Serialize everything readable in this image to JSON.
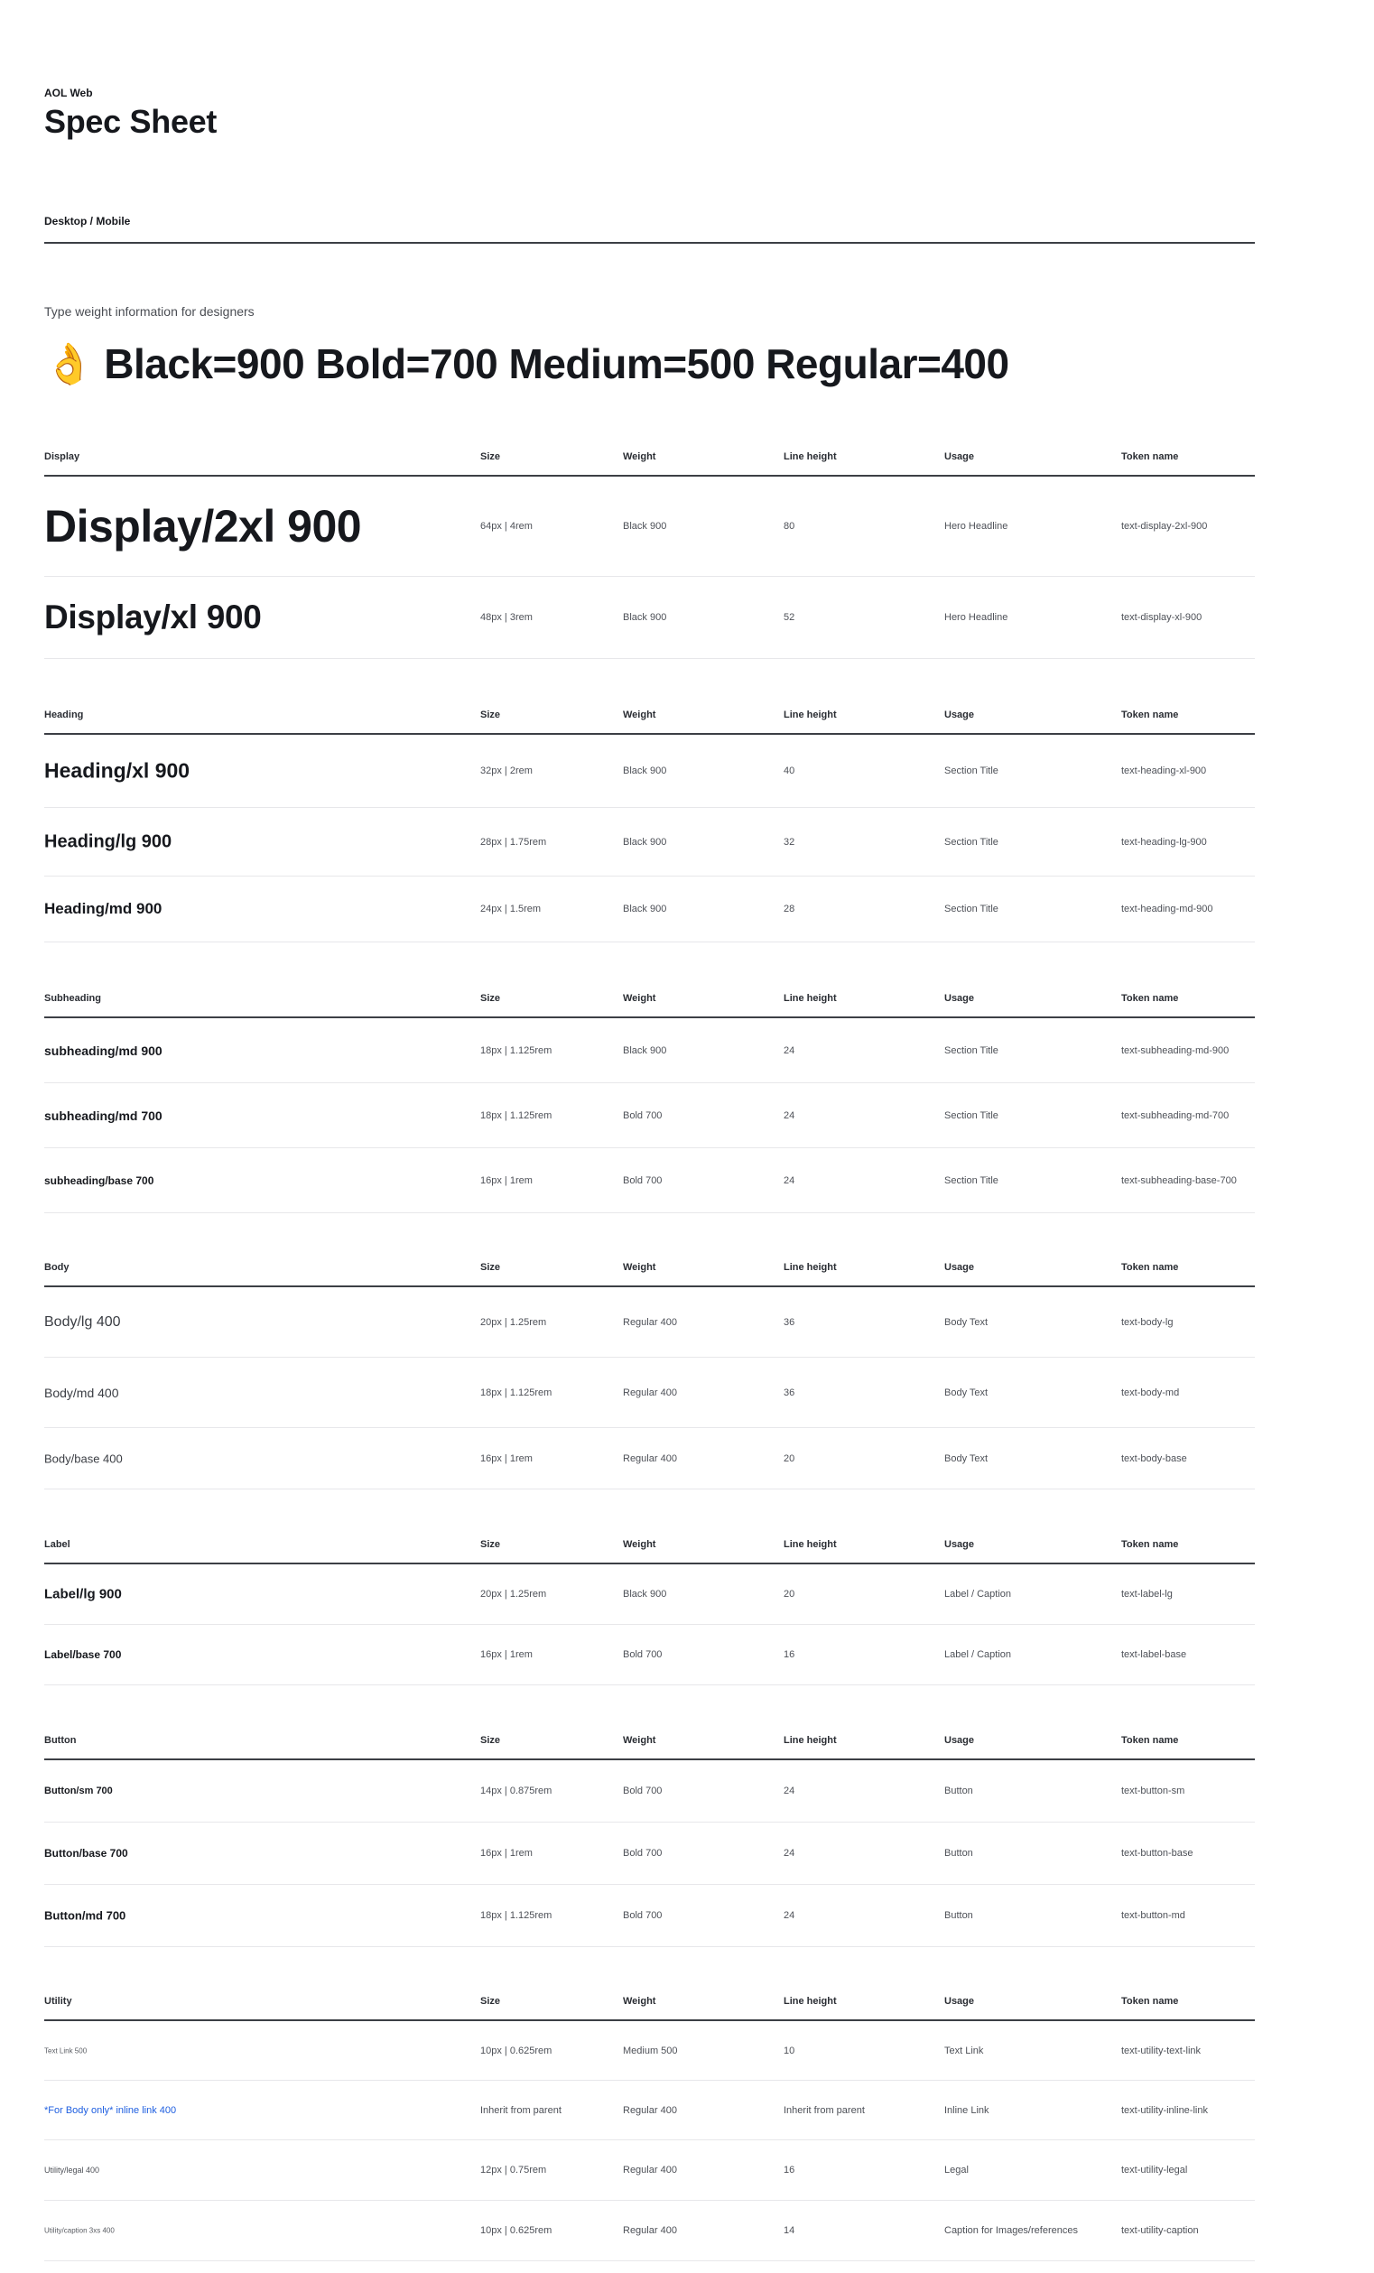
{
  "header": {
    "eyebrow": "AOL Web",
    "title": "Spec Sheet",
    "platform": "Desktop / Mobile"
  },
  "intro": "Type weight information for designers",
  "weights_line": {
    "emoji": "👌",
    "text": "Black=900 Bold=700 Medium=500 Regular=400"
  },
  "columns": {
    "size": "Size",
    "weight": "Weight",
    "line_height": "Line height",
    "usage": "Usage",
    "token": "Token name"
  },
  "sections": [
    {
      "name": "Display",
      "rows": [
        {
          "name": "Display/2xl 900",
          "size": "64px | 4rem",
          "weight": "Black 900",
          "line_height": "80",
          "usage": "Hero Headline",
          "token": "text-display-2xl-900"
        },
        {
          "name": "Display/xl 900",
          "size": "48px | 3rem",
          "weight": "Black 900",
          "line_height": "52",
          "usage": "Hero Headline",
          "token": "text-display-xl-900"
        }
      ]
    },
    {
      "name": "Heading",
      "rows": [
        {
          "name": "Heading/xl 900",
          "size": "32px | 2rem",
          "weight": "Black 900",
          "line_height": "40",
          "usage": "Section Title",
          "token": "text-heading-xl-900"
        },
        {
          "name": "Heading/lg 900",
          "size": "28px | 1.75rem",
          "weight": "Black 900",
          "line_height": "32",
          "usage": "Section Title",
          "token": "text-heading-lg-900"
        },
        {
          "name": "Heading/md 900",
          "size": "24px | 1.5rem",
          "weight": "Black 900",
          "line_height": "28",
          "usage": "Section Title",
          "token": "text-heading-md-900"
        }
      ]
    },
    {
      "name": "Subheading",
      "rows": [
        {
          "name": "subheading/md 900",
          "size": "18px | 1.125rem",
          "weight": "Black 900",
          "line_height": "24",
          "usage": "Section Title",
          "token": "text-subheading-md-900"
        },
        {
          "name": "subheading/md 700",
          "size": "18px | 1.125rem",
          "weight": "Bold 700",
          "line_height": "24",
          "usage": "Section Title",
          "token": "text-subheading-md-700"
        },
        {
          "name": "subheading/base 700",
          "size": "16px | 1rem",
          "weight": "Bold 700",
          "line_height": "24",
          "usage": "Section Title",
          "token": "text-subheading-base-700"
        }
      ]
    },
    {
      "name": "Body",
      "rows": [
        {
          "name": "Body/lg 400",
          "size": "20px | 1.25rem",
          "weight": "Regular 400",
          "line_height": "36",
          "usage": "Body Text",
          "token": "text-body-lg"
        },
        {
          "name": "Body/md 400",
          "size": "18px | 1.125rem",
          "weight": "Regular 400",
          "line_height": "36",
          "usage": "Body Text",
          "token": "text-body-md"
        },
        {
          "name": "Body/base 400",
          "size": "16px | 1rem",
          "weight": "Regular 400",
          "line_height": "20",
          "usage": "Body Text",
          "token": "text-body-base"
        }
      ]
    },
    {
      "name": "Label",
      "rows": [
        {
          "name": "Label/lg 900",
          "size": "20px | 1.25rem",
          "weight": "Black 900",
          "line_height": "20",
          "usage": "Label / Caption",
          "token": "text-label-lg"
        },
        {
          "name": "Label/base 700",
          "size": "16px | 1rem",
          "weight": "Bold 700",
          "line_height": "16",
          "usage": "Label / Caption",
          "token": "text-label-base"
        }
      ]
    },
    {
      "name": "Button",
      "rows": [
        {
          "name": "Button/sm 700",
          "size": "14px | 0.875rem",
          "weight": "Bold 700",
          "line_height": "24",
          "usage": "Button",
          "token": "text-button-sm"
        },
        {
          "name": "Button/base 700",
          "size": "16px | 1rem",
          "weight": "Bold 700",
          "line_height": "24",
          "usage": "Button",
          "token": "text-button-base"
        },
        {
          "name": "Button/md 700",
          "size": "18px | 1.125rem",
          "weight": "Bold 700",
          "line_height": "24",
          "usage": "Button",
          "token": "text-button-md"
        }
      ]
    },
    {
      "name": "Utility",
      "rows": [
        {
          "name": "Text Link 500",
          "size": "10px  | 0.625rem",
          "weight": "Medium 500",
          "line_height": "10",
          "usage": "Text Link",
          "token": "text-utility-text-link"
        },
        {
          "name": "*For Body only* inline link 400",
          "size": "Inherit from parent",
          "weight": "Regular 400",
          "line_height": "Inherit from parent",
          "usage": "Inline Link",
          "token": "text-utility-inline-link"
        },
        {
          "name": "Utility/legal 400",
          "size": "12px | 0.75rem",
          "weight": "Regular 400",
          "line_height": "16",
          "usage": "Legal",
          "token": "text-utility-legal"
        },
        {
          "name": "Utility/caption 3xs 400",
          "size": "10px  | 0.625rem",
          "weight": "Regular 400",
          "line_height": "14",
          "usage": "Caption for Images/references",
          "token": "text-utility-caption"
        }
      ]
    }
  ]
}
